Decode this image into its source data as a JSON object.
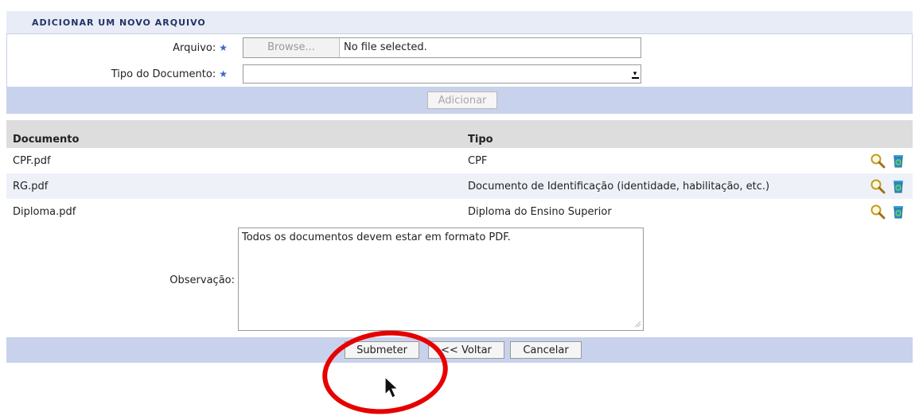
{
  "form": {
    "title": "ADICIONAR UM NOVO ARQUIVO",
    "arquivo_label": "Arquivo:",
    "browse_label": "Browse...",
    "file_status": "No file selected.",
    "tipo_label": "Tipo do Documento:",
    "tipo_value": "",
    "required_mark": "★",
    "add_button": "Adicionar"
  },
  "table": {
    "headers": [
      "Documento",
      "Tipo"
    ],
    "rows": [
      {
        "documento": "CPF.pdf",
        "tipo": "CPF"
      },
      {
        "documento": "RG.pdf",
        "tipo": "Documento de Identificação (identidade, habilitação, etc.)"
      },
      {
        "documento": "Diploma.pdf",
        "tipo": "Diploma do Ensino Superior"
      }
    ],
    "row_icons": [
      "magnifier-icon",
      "recycle-bin-icon"
    ]
  },
  "observacao": {
    "label": "Observação:",
    "value": "Todos os documentos devem estar em formato PDF."
  },
  "actions": {
    "submit": "Submeter",
    "back": "<< Voltar",
    "cancel": "Cancelar"
  },
  "colors": {
    "highlight_circle": "#e60000",
    "caption_text": "#223366",
    "bar_background": "#c8d2ec"
  }
}
